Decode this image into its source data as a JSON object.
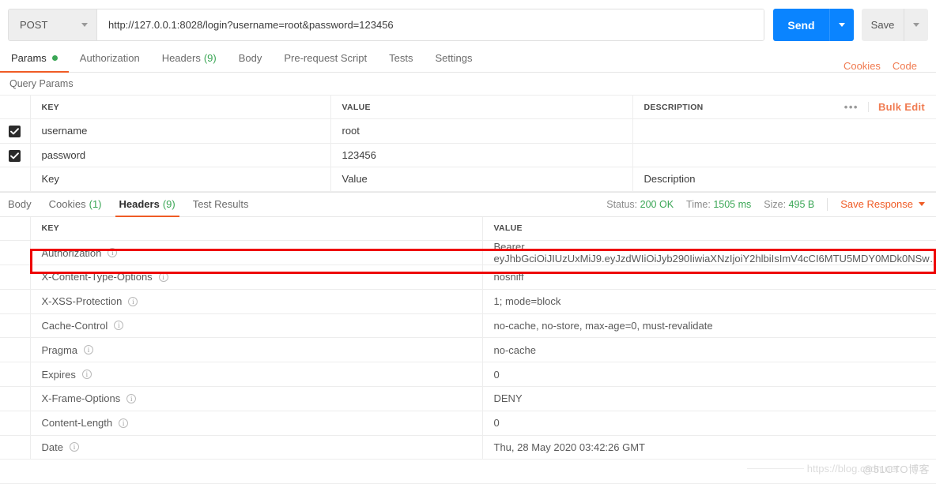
{
  "request": {
    "method": "POST",
    "url": "http://127.0.0.1:8028/login?username=root&password=123456",
    "send_label": "Send",
    "save_label": "Save"
  },
  "request_tabs": [
    {
      "label": "Params",
      "badge": "",
      "dot": true,
      "active": true
    },
    {
      "label": "Authorization",
      "badge": "",
      "dot": false,
      "active": false
    },
    {
      "label": "Headers",
      "badge": "(9)",
      "dot": false,
      "active": false
    },
    {
      "label": "Body",
      "badge": "",
      "dot": false,
      "active": false
    },
    {
      "label": "Pre-request Script",
      "badge": "",
      "dot": false,
      "active": false
    },
    {
      "label": "Tests",
      "badge": "",
      "dot": false,
      "active": false
    },
    {
      "label": "Settings",
      "badge": "",
      "dot": false,
      "active": false
    }
  ],
  "tabs_right": {
    "cookies": "Cookies",
    "code": "Code"
  },
  "query_params": {
    "section_title": "Query Params",
    "columns": {
      "key": "KEY",
      "value": "VALUE",
      "description": "DESCRIPTION"
    },
    "more_dots": "•••",
    "bulk_edit": "Bulk Edit",
    "rows": [
      {
        "checked": true,
        "key": "username",
        "value": "root",
        "description": ""
      },
      {
        "checked": true,
        "key": "password",
        "value": "123456",
        "description": ""
      }
    ],
    "placeholder_row": {
      "key": "Key",
      "value": "Value",
      "description": "Description"
    }
  },
  "response_tabs": [
    {
      "label": "Body",
      "badge": "",
      "active": false
    },
    {
      "label": "Cookies",
      "badge": "(1)",
      "active": false
    },
    {
      "label": "Headers",
      "badge": "(9)",
      "active": true
    },
    {
      "label": "Test Results",
      "badge": "",
      "active": false
    }
  ],
  "response_meta": {
    "status_label": "Status:",
    "status_value": "200 OK",
    "time_label": "Time:",
    "time_value": "1505 ms",
    "size_label": "Size:",
    "size_value": "495 B",
    "save_response": "Save Response"
  },
  "response_headers": {
    "columns": {
      "key": "KEY",
      "value": "VALUE"
    },
    "rows": [
      {
        "key": "Authorization",
        "value": "Bearer eyJhbGciOiJIUzUxMiJ9.eyJzdWIiOiJyb290IiwiaXNzIjoiY2hlbiIsImV4cCI6MTU5MDY0MDk0NSw…",
        "highlighted": true
      },
      {
        "key": "X-Content-Type-Options",
        "value": "nosniff",
        "highlighted": false
      },
      {
        "key": "X-XSS-Protection",
        "value": "1; mode=block",
        "highlighted": false
      },
      {
        "key": "Cache-Control",
        "value": "no-cache, no-store, max-age=0, must-revalidate",
        "highlighted": false
      },
      {
        "key": "Pragma",
        "value": "no-cache",
        "highlighted": false
      },
      {
        "key": "Expires",
        "value": "0",
        "highlighted": false
      },
      {
        "key": "X-Frame-Options",
        "value": "DENY",
        "highlighted": false
      },
      {
        "key": "Content-Length",
        "value": "0",
        "highlighted": false
      },
      {
        "key": "Date",
        "value": "Thu, 28 May 2020 03:42:26 GMT",
        "highlighted": false
      }
    ]
  },
  "watermark": {
    "url": "https://blog.csdn.net",
    "cto": "@51CTO博客"
  },
  "colors": {
    "accent_orange": "#ef5b25",
    "send_blue": "#0a84ff",
    "status_green": "#3aa655",
    "highlight_red": "#ee0000"
  }
}
